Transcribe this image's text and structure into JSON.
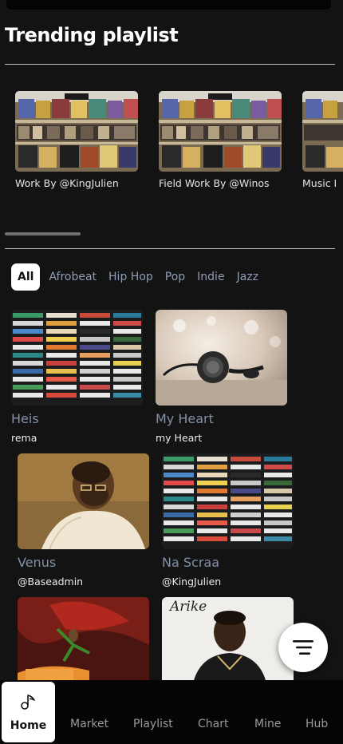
{
  "header": {
    "title": "Trending playlist"
  },
  "trending": [
    {
      "label": "Work By @KingJulien",
      "image": "record-store"
    },
    {
      "label": "Field Work By @Winos",
      "image": "record-store"
    },
    {
      "label": "Music I",
      "image": "record-store"
    }
  ],
  "genres": [
    "All",
    "Afrobeat",
    "Hip Hop",
    "Pop",
    "Indie",
    "Jazz"
  ],
  "songs": [
    {
      "title": "Heis",
      "artist": "rema",
      "image": "cassette-wall"
    },
    {
      "title": "My Heart",
      "artist": "my Heart",
      "image": "headphones"
    },
    {
      "title": "Venus",
      "artist": "@Baseadmin",
      "image": "portrait-man"
    },
    {
      "title": "Na Scraa",
      "artist": "@KingJulien",
      "image": "cassette-wall"
    },
    {
      "title": "",
      "artist": "",
      "image": "album-art-red"
    },
    {
      "title": "",
      "artist": "",
      "image": "album-art-arike"
    }
  ],
  "album_signature": "Arike",
  "nav": {
    "home": "Home",
    "market": "Market",
    "playlist": "Playlist",
    "chart": "Chart",
    "mine": "Mine",
    "hub": "Hub"
  },
  "icons": {
    "fab": "menu-lines-icon",
    "home": "music-note-icon"
  },
  "colors": {
    "background": "#131313",
    "nav": "#050505",
    "title_muted": "#8391a8",
    "accent": "#ffffff"
  }
}
